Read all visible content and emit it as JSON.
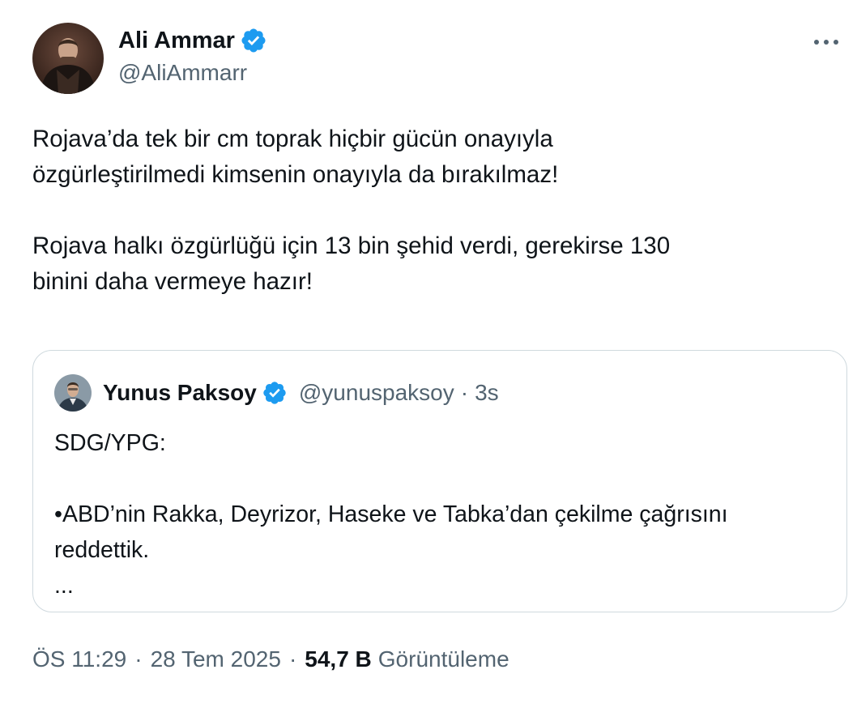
{
  "author": {
    "display_name": "Ali Ammar",
    "handle": "@AliAmmarr",
    "verified_icon": "verified-badge-icon",
    "avatar_icon": "avatar"
  },
  "more_icon": "more-options-icon",
  "tweet_text": "Rojava’da tek bir cm toprak hiçbir gücün onayıyla\nözgürleştirilmedi kimsenin onayıyla da bırakılmaz!\n\nRojava halkı özgürlüğü için 13 bin şehid verdi, gerekirse 130\nbinini daha vermeye hazır!",
  "quoted_tweet": {
    "display_name": "Yunus Paksoy",
    "handle": "@yunuspaksoy",
    "separator": "·",
    "time": "3s",
    "text": "SDG/YPG:\n\n•ABD’nin Rakka, Deyrizor, Haseke ve Tabka’dan çekilme çağrısını\nreddettik.\n..."
  },
  "meta": {
    "time": "ÖS 11:29",
    "separator": "·",
    "date": "28 Tem 2025",
    "views_count": "54,7 B",
    "views_label": "Görüntüleme"
  },
  "colors": {
    "text_primary": "#0f1419",
    "text_secondary": "#536471",
    "verified": "#1d9bf0",
    "border": "#cfd9de"
  }
}
